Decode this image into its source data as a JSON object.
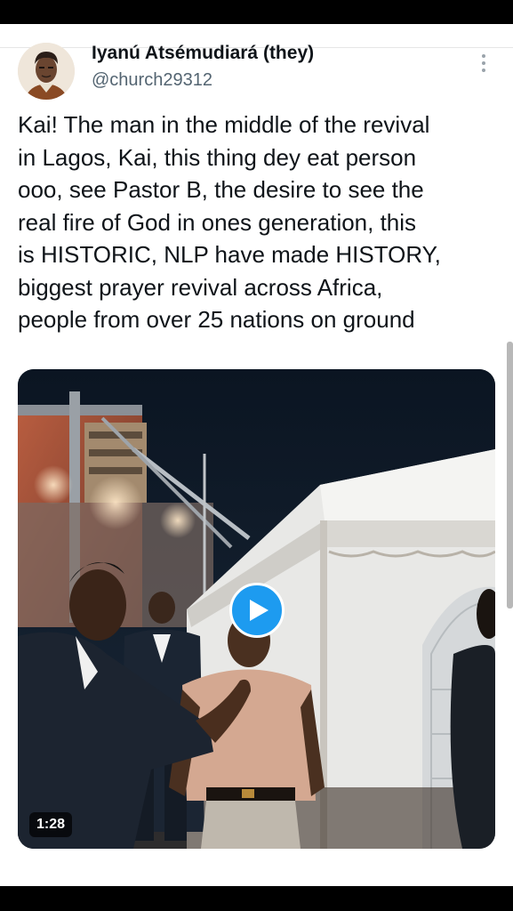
{
  "post": {
    "author_name": "Iyanú Atsémudiará (they)",
    "handle": "@church29312",
    "text_lines": [
      "Kai! The man in the middle of the revival",
      "in Lagos, Kai, this thing dey eat person",
      "ooo, see Pastor B, the desire to see the",
      "real fire of God in ones generation, this",
      "is HISTORIC, NLP have made HISTORY,",
      "biggest prayer revival across Africa,",
      "people from over 25 nations on ground"
    ]
  },
  "video": {
    "duration": "1:28"
  },
  "colors": {
    "accent": "#1d9bf0",
    "text": "#0f1419",
    "secondary": "#536471"
  }
}
